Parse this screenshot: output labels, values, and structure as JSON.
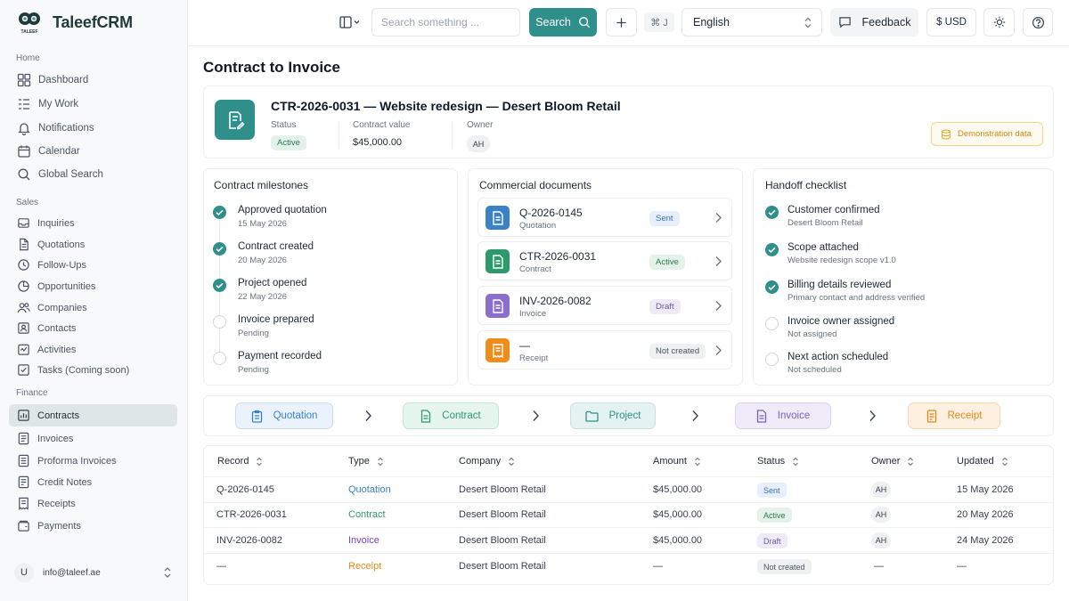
{
  "app": {
    "name": "TaleefCRM",
    "logo_text": "TALEEF"
  },
  "sidebar": {
    "sections": [
      {
        "label": "Home",
        "items": [
          {
            "label": "Dashboard",
            "icon": "dashboard-icon"
          },
          {
            "label": "My Work",
            "icon": "list-icon"
          },
          {
            "label": "Notifications",
            "icon": "bell-icon"
          },
          {
            "label": "Calendar",
            "icon": "calendar-icon"
          },
          {
            "label": "Global Search",
            "icon": "search-icon"
          }
        ]
      },
      {
        "label": "Sales",
        "items": [
          {
            "label": "Inquiries",
            "icon": "inbox-icon"
          },
          {
            "label": "Quotations",
            "icon": "document-icon"
          },
          {
            "label": "Follow-Ups",
            "icon": "clock-icon"
          },
          {
            "label": "Opportunities",
            "icon": "pie-chart-icon"
          },
          {
            "label": "Companies",
            "icon": "users-icon"
          },
          {
            "label": "Contacts",
            "icon": "contact-card-icon"
          },
          {
            "label": "Activities",
            "icon": "activity-icon"
          },
          {
            "label": "Tasks (Coming soon)",
            "icon": "checkbox-icon"
          }
        ]
      },
      {
        "label": "Finance",
        "items": [
          {
            "label": "Contracts",
            "icon": "chart-icon",
            "active": true
          },
          {
            "label": "Invoices",
            "icon": "invoice-icon"
          },
          {
            "label": "Proforma Invoices",
            "icon": "file-icon"
          },
          {
            "label": "Credit Notes",
            "icon": "note-icon"
          },
          {
            "label": "Receipts",
            "icon": "receipt-icon"
          },
          {
            "label": "Payments",
            "icon": "wallet-icon"
          }
        ]
      }
    ],
    "user": {
      "initial": "U",
      "email": "info@taleef.ae"
    }
  },
  "topbar": {
    "search_placeholder": "Search something ...",
    "search_button": "Search",
    "shortcut": "⌘ J",
    "language": "English",
    "feedback": "Feedback",
    "currency": "$ USD"
  },
  "page": {
    "title": "Contract to Invoice"
  },
  "summary": {
    "heading": "CTR-2026-0031 — Website redesign — Desert Bloom Retail",
    "status_label": "Status",
    "status_value": "Active",
    "value_label": "Contract value",
    "value": "$45,000.00",
    "owner_label": "Owner",
    "owner_initials": "AH",
    "demo_badge": "Demonstration data"
  },
  "milestones": {
    "title": "Contract milestones",
    "items": [
      {
        "title": "Approved quotation",
        "sub": "15 May 2026",
        "done": true
      },
      {
        "title": "Contract created",
        "sub": "20 May 2026",
        "done": true
      },
      {
        "title": "Project opened",
        "sub": "22 May 2026",
        "done": true
      },
      {
        "title": "Invoice prepared",
        "sub": "Pending",
        "done": false
      },
      {
        "title": "Payment recorded",
        "sub": "Pending",
        "done": false
      }
    ]
  },
  "documents": {
    "title": "Commercial documents",
    "items": [
      {
        "id": "Q-2026-0145",
        "type": "Quotation",
        "status": "Sent",
        "color": "#3b82c4"
      },
      {
        "id": "CTR-2026-0031",
        "type": "Contract",
        "status": "Active",
        "color": "#2e9a6b"
      },
      {
        "id": "INV-2026-0082",
        "type": "Invoice",
        "status": "Draft",
        "color": "#8b6fcf"
      },
      {
        "id": "—",
        "type": "Receipt",
        "status": "Not created",
        "color": "#f08c1a"
      }
    ]
  },
  "checklist": {
    "title": "Handoff checklist",
    "items": [
      {
        "title": "Customer confirmed",
        "sub": "Desert Bloom Retail",
        "done": true
      },
      {
        "title": "Scope attached",
        "sub": "Website redesign scope v1.0",
        "done": true
      },
      {
        "title": "Billing details reviewed",
        "sub": "Primary contact and address verified",
        "done": true
      },
      {
        "title": "Invoice owner assigned",
        "sub": "Not assigned",
        "done": false
      },
      {
        "title": "Next action scheduled",
        "sub": "Not scheduled",
        "done": false
      }
    ]
  },
  "flow": [
    {
      "label": "Quotation",
      "color": "#3b82c4",
      "bg": "#eaf2fb",
      "border": "#c9dcf2"
    },
    {
      "label": "Contract",
      "color": "#2e9a6b",
      "bg": "#e6f5ee",
      "border": "#c4e6d4"
    },
    {
      "label": "Project",
      "color": "#2f8f8a",
      "bg": "#e5f2f2",
      "border": "#c8e2e1"
    },
    {
      "label": "Invoice",
      "color": "#7a5fc0",
      "bg": "#efebf9",
      "border": "#dcd3f1"
    },
    {
      "label": "Receipt",
      "color": "#e48a16",
      "bg": "#fdf0e1",
      "border": "#f6d8b4"
    }
  ],
  "table": {
    "headers": [
      "Record",
      "Type",
      "Company",
      "Amount",
      "Status",
      "Owner",
      "Updated"
    ],
    "rows": [
      {
        "record": "Q-2026-0145",
        "type": "Quotation",
        "type_color": "#3b82c4",
        "company": "Desert Bloom Retail",
        "amount": "$45,000.00",
        "status": "Sent",
        "owner": "AH",
        "updated": "15 May 2026"
      },
      {
        "record": "CTR-2026-0031",
        "type": "Contract",
        "type_color": "#2e9a6b",
        "company": "Desert Bloom Retail",
        "amount": "$45,000.00",
        "status": "Active",
        "owner": "AH",
        "updated": "20 May 2026"
      },
      {
        "record": "INV-2026-0082",
        "type": "Invoice",
        "type_color": "#7a3fc0",
        "company": "Desert Bloom Retail",
        "amount": "$45,000.00",
        "status": "Draft",
        "owner": "AH",
        "updated": "24 May 2026"
      },
      {
        "record": "—",
        "type": "Receipt",
        "type_color": "#e48a16",
        "company": "Desert Bloom Retail",
        "amount": "—",
        "status": "Not created",
        "owner": "—",
        "updated": "—"
      }
    ]
  },
  "colors": {
    "accent": "#2f8f8a",
    "demo_badge": "#f5a524"
  }
}
